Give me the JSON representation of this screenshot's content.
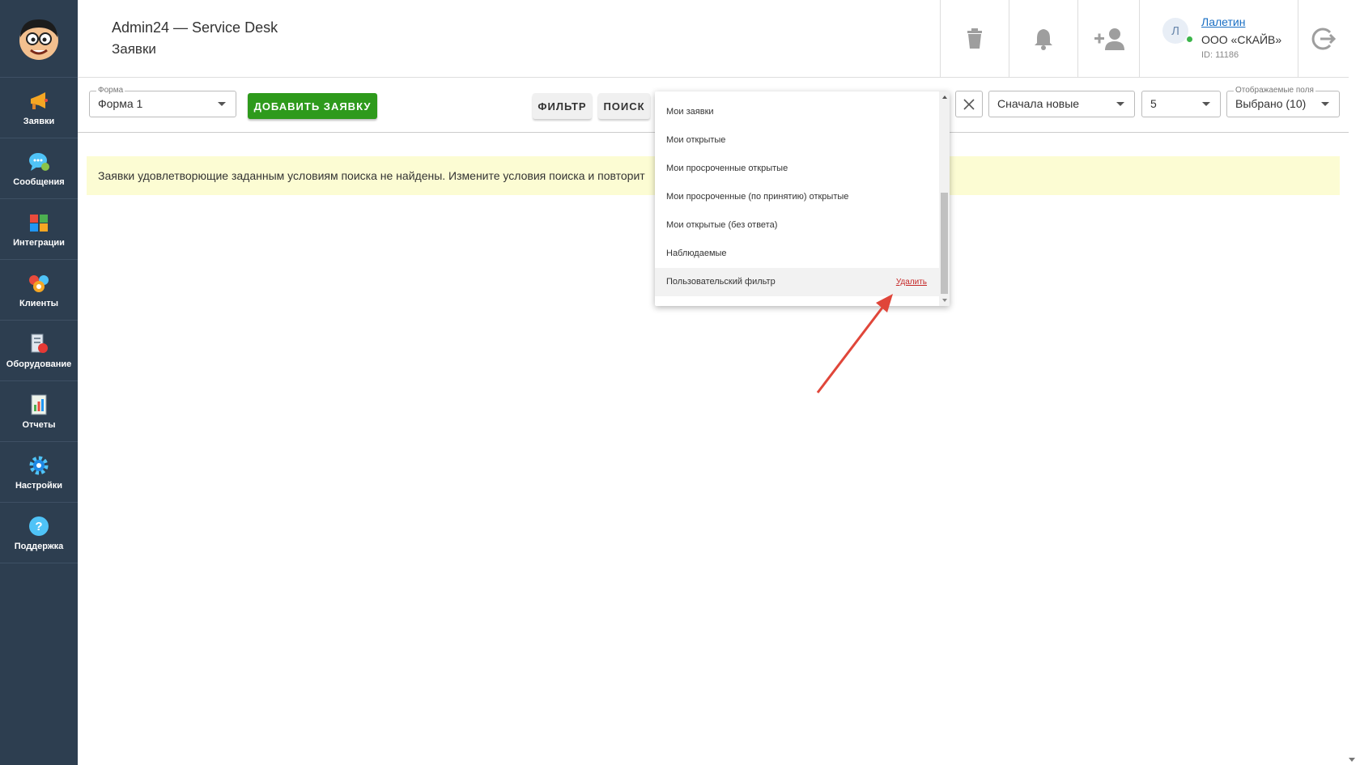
{
  "header": {
    "app_title": "Admin24 — Service Desk",
    "page_title": "Заявки"
  },
  "sidebar": {
    "items": [
      {
        "label": "Заявки",
        "icon": "megaphone-icon"
      },
      {
        "label": "Сообщения",
        "icon": "chat-bubble-icon"
      },
      {
        "label": "Интеграции",
        "icon": "puzzle-icon"
      },
      {
        "label": "Клиенты",
        "icon": "people-icon"
      },
      {
        "label": "Оборудование",
        "icon": "equipment-icon"
      },
      {
        "label": "Отчеты",
        "icon": "report-icon"
      },
      {
        "label": "Настройки",
        "icon": "gear-icon"
      },
      {
        "label": "Поддержка",
        "icon": "question-icon"
      }
    ]
  },
  "user": {
    "avatar_letter": "Л",
    "name": "Лалетин",
    "org": "ООО «СКАЙВ»",
    "id": "ID: 11186"
  },
  "toolbar": {
    "form_label": "Форма",
    "form_value": "Форма 1",
    "add_button": "ДОБАВИТЬ ЗАЯВКУ",
    "filter_button": "ФИЛЬТР",
    "search_button": "ПОИСК",
    "sort_value": "Сначала новые",
    "per_page_value": "5",
    "fields_label": "Отображаемые поля",
    "fields_value": "Выбрано (10)"
  },
  "notice": "Заявки удовлетворющие заданным условиям поиска не найдены. Измените условия поиска и повторит",
  "filter_dropdown": {
    "items": [
      "Мои заявки",
      "Мои открытые",
      "Мои просроченные открытые",
      "Мои просроченные (по принятию) открытые",
      "Мои открытые (без ответа)",
      "Наблюдаемые",
      "Пользовательский фильтр"
    ],
    "delete_label": "Удалить"
  },
  "colors": {
    "sidebar": "#2d3e50",
    "accent_green": "#2e9a1c",
    "link_blue": "#1a6fc4",
    "delete_red": "#c62828",
    "notice_bg": "#fcfcd3",
    "annotation_arrow": "#e0463a"
  }
}
